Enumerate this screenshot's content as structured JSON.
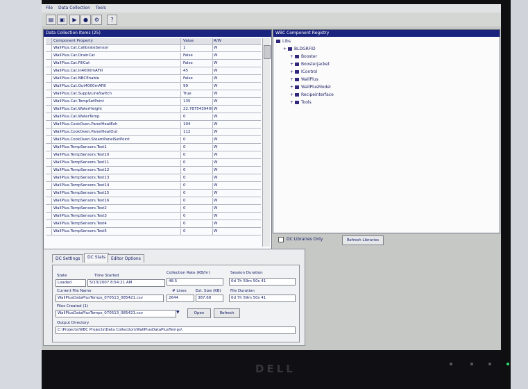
{
  "menu": [
    "File",
    "Data Collection",
    "Tools"
  ],
  "left_panel": {
    "title": "Data Collection Items (25)",
    "headers": [
      "Component Property",
      "Value",
      "R/W"
    ],
    "rows": [
      {
        "property": "WallPlus.Cat.CalibrateSensor",
        "value": "1",
        "rw": "W"
      },
      {
        "property": "WallPlus.Cat.DrainCat",
        "value": "False",
        "rw": "W"
      },
      {
        "property": "WallPlus.Cat.FillCat",
        "value": "False",
        "rw": "W"
      },
      {
        "property": "WallPlus.Cat.In4000mAFill",
        "value": "45",
        "rw": "W"
      },
      {
        "property": "WallPlus.Cat.NBCEnable",
        "value": "False",
        "rw": "W"
      },
      {
        "property": "WallPlus.Cat.Out4000mAFill",
        "value": "99",
        "rw": "W"
      },
      {
        "property": "WallPlus.Cat.SupplyLineSwitch",
        "value": "True",
        "rw": "W"
      },
      {
        "property": "WallPlus.Cat.TempSetPoint",
        "value": "135",
        "rw": "W"
      },
      {
        "property": "WallPlus.Cat.WaterHeight",
        "value": "22.7875439400",
        "rw": "W"
      },
      {
        "property": "WallPlus.Cat.WaterTemp",
        "value": "0",
        "rw": "W"
      },
      {
        "property": "WallPlus.CookOven.PanelHeatExh",
        "value": "104",
        "rw": "W"
      },
      {
        "property": "WallPlus.CookOven.PanelHeatOut",
        "value": "112",
        "rw": "W"
      },
      {
        "property": "WallPlus.CookOven.SteamPanelSetPoint",
        "value": "0",
        "rw": "W"
      },
      {
        "property": "WallPlus.TempSensors.Test1",
        "value": "0",
        "rw": "W"
      },
      {
        "property": "WallPlus.TempSensors.Test10",
        "value": "0",
        "rw": "W"
      },
      {
        "property": "WallPlus.TempSensors.Test11",
        "value": "0",
        "rw": "W"
      },
      {
        "property": "WallPlus.TempSensors.Test12",
        "value": "0",
        "rw": "W"
      },
      {
        "property": "WallPlus.TempSensors.Test13",
        "value": "0",
        "rw": "W"
      },
      {
        "property": "WallPlus.TempSensors.Test14",
        "value": "0",
        "rw": "W"
      },
      {
        "property": "WallPlus.TempSensors.Test15",
        "value": "0",
        "rw": "W"
      },
      {
        "property": "WallPlus.TempSensors.Test16",
        "value": "0",
        "rw": "W"
      },
      {
        "property": "WallPlus.TempSensors.Test2",
        "value": "0",
        "rw": "W"
      },
      {
        "property": "WallPlus.TempSensors.Test3",
        "value": "0",
        "rw": "W"
      },
      {
        "property": "WallPlus.TempSensors.Test4",
        "value": "0",
        "rw": "W"
      },
      {
        "property": "WallPlus.TempSensors.Test5",
        "value": "0",
        "rw": "W"
      }
    ]
  },
  "right_panel": {
    "title": "WBC Component Registry",
    "tree": [
      {
        "label": "Libs",
        "level": 0
      },
      {
        "label": "BLDGRFID",
        "level": 1
      },
      {
        "label": "Booster",
        "level": 2
      },
      {
        "label": "Boosterjacket",
        "level": 2
      },
      {
        "label": "IControl",
        "level": 2
      },
      {
        "label": "WallPlus",
        "level": 2
      },
      {
        "label": "WallPlusModel",
        "level": 2
      },
      {
        "label": "Recipeinterface",
        "level": 2
      },
      {
        "label": "Tools",
        "level": 2
      }
    ],
    "dc_libraries_only": "DC Libraries Only",
    "refresh_button": "Refresh Libraries"
  },
  "bottom": {
    "tabs": [
      "DC Settings",
      "DC Stats",
      "Editor Options"
    ],
    "state_label": "State",
    "state_value": "Loaded",
    "time_started_label": "Time Started",
    "time_started_value": "5/13/2007 8:54:21 AM",
    "collection_rate_label": "Collection Rate (KB/hr)",
    "collection_rate_value": "48.5",
    "session_duration_label": "Session Duration",
    "session_duration_value": "0d 7h 59m 50s 41",
    "current_file_label": "Current File Name",
    "current_file_value": "WallPlusDataPlusTemps_070513_085421.csv",
    "lines_label": "# Lines",
    "lines_value": "2644",
    "est_size_label": "Est. Size (KB)",
    "est_size_value": "387.68",
    "file_duration_label": "File Duration",
    "file_duration_value": "0d 7h 59m 50s 41",
    "files_created_label": "Files Created (1)",
    "files_created_value": "WallPlusDataPlusTemps_070513_085421.csv",
    "open_button": "Open",
    "refresh_button": "Refresh",
    "output_dir_label": "Output Directory",
    "output_dir_value": "C:\\Projects\\WBC Projects\\Data Collection\\WallPlusDataPlusTemps\\"
  },
  "monitor": {
    "brand": "DELL"
  }
}
